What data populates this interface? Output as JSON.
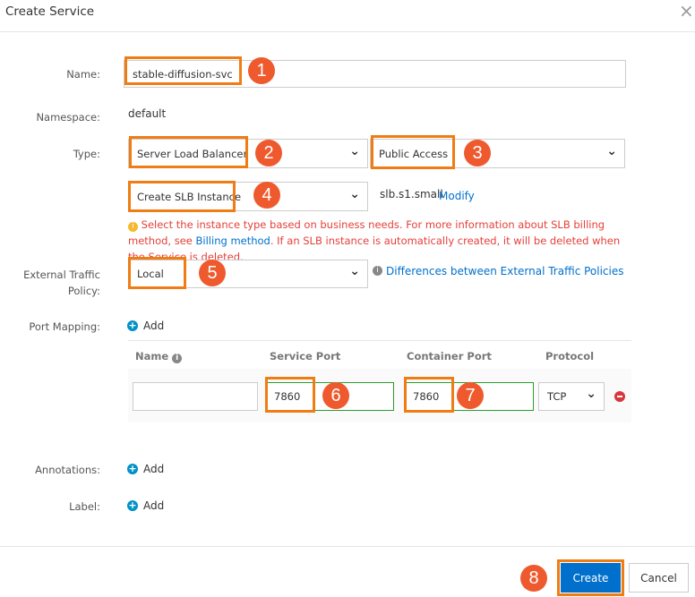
{
  "dialog": {
    "title": "Create Service",
    "close": "×"
  },
  "form": {
    "name_label": "Name:",
    "name_value": "stable-diffusion-svc",
    "namespace_label": "Namespace:",
    "namespace_value": "default",
    "type_label": "Type:",
    "type_value": "Server Load Balancer",
    "access_value": "Public Access",
    "slb_value": "Create SLB Instance",
    "slb_spec": "slb.s1.small",
    "modify": "Modify",
    "info_text_1": "Select the instance type based on business needs. For more information about SLB billing method, see",
    "billing_link": "Billing method",
    "info_text_2": ". If an SLB instance is automatically created, it will be deleted when the Service is deleted.",
    "etp_label_1": "External Traffic",
    "etp_label_2": "Policy:",
    "etp_value": "Local",
    "etp_link": "Differences between External Traffic Policies",
    "port_label": "Port Mapping:",
    "add": "Add",
    "port_headers": [
      "Name",
      "Service Port",
      "Container Port",
      "Protocol"
    ],
    "port_row": {
      "name": "",
      "service_port": "7860",
      "container_port": "7860",
      "protocol": "TCP"
    },
    "annotations_label": "Annotations:",
    "label_label": "Label:"
  },
  "footer": {
    "create": "Create",
    "cancel": "Cancel"
  },
  "markers": [
    "1",
    "2",
    "3",
    "4",
    "5",
    "6",
    "7",
    "8"
  ],
  "colors": {
    "primary": "#0070cc",
    "marker": "#ee5a2e",
    "highlight": "#f07c14",
    "warning": "#e5403a"
  }
}
